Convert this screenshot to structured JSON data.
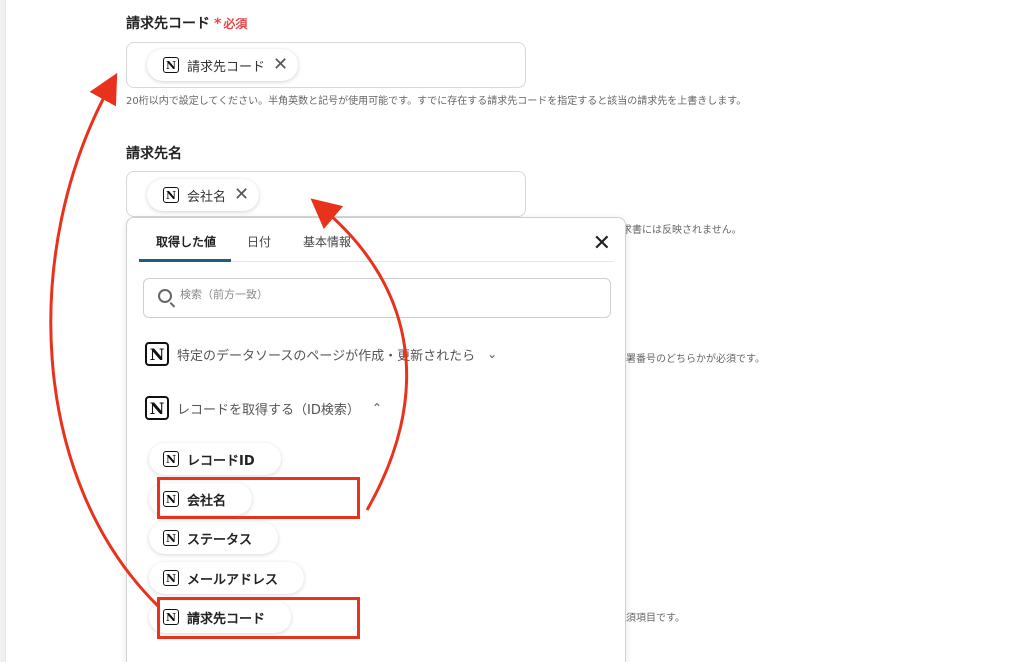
{
  "field1": {
    "label": "請求先コード",
    "required_star": "*",
    "required_text": "必須",
    "chip_label": "請求先コード",
    "chip_remove": "✕",
    "help": "20桁以内で設定してください。半角英数と記号が使用可能です。すでに存在する請求先コードを指定すると該当の請求先を上書きします。"
  },
  "field2": {
    "label": "請求先名",
    "chip_label": "会社名",
    "chip_remove": "✕",
    "help_partial": "求書には反映されません。"
  },
  "hidden_help": {
    "help3_partial": "署番号のどちらかが必須です。",
    "help4_partial": "須項目です。"
  },
  "popup": {
    "tabs": [
      {
        "label": "取得した値",
        "active": true
      },
      {
        "label": "日付",
        "active": false
      },
      {
        "label": "基本情報",
        "active": false
      }
    ],
    "close": "✕",
    "search_placeholder": "検索（前方一致）",
    "sections": [
      {
        "label": "特定のデータソースのページが作成・更新されたら",
        "chevron": "⌄",
        "expanded": false
      },
      {
        "label": "レコードを取得する（ID検索）",
        "chevron": "⌃",
        "expanded": true
      }
    ],
    "items": [
      {
        "label": "レコードID"
      },
      {
        "label": "会社名"
      },
      {
        "label": "ステータス"
      },
      {
        "label": "メールアドレス"
      },
      {
        "label": "請求先コード"
      }
    ]
  },
  "icons": {
    "notion": "notion-icon",
    "search": "search-icon",
    "close": "close-icon"
  },
  "colors": {
    "annotation_red": "#e8321c",
    "required_red": "#e8484a",
    "tab_underline": "#1f5e7a"
  }
}
